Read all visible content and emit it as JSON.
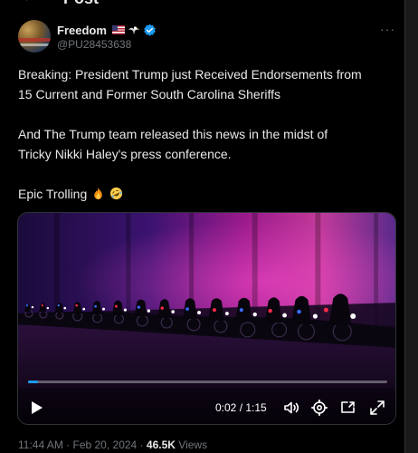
{
  "header": {
    "back_icon": "arrow-left-icon",
    "title": "Post"
  },
  "author": {
    "display_name": "Freedom",
    "handle": "@PU28453638",
    "badges": [
      "us-flag-icon",
      "eagle-icon",
      "verified-badge-icon"
    ],
    "verified_color": "#1d9bf0"
  },
  "more_icon": "more-dots-icon",
  "tweet": {
    "line1": "Breaking: President Trump just Received Endorsements from",
    "line2": "15 Current and Former South Carolina Sheriffs",
    "line3": "And The Trump team released this news in the midst of",
    "line4": "Tricky Nikki Haley's  press conference.",
    "line5": "Epic Trolling",
    "emojis": [
      "fire-emoji",
      "rofl-emoji"
    ]
  },
  "video": {
    "time_display": "0:02 / 1:15",
    "progress": 0.027,
    "controls": [
      "play-icon",
      "volume-icon",
      "settings-gear-icon",
      "picture-in-picture-icon",
      "fullscreen-icon"
    ]
  },
  "meta": {
    "time": "11:44 AM",
    "separator": "·",
    "date": "Feb 20, 2024",
    "separator2": "·",
    "views_count": "46.5K",
    "views_label": "Views"
  },
  "colors": {
    "background": "#000000",
    "text": "#e7e9ea",
    "secondary": "#71767b",
    "accent": "#1d9bf0"
  }
}
